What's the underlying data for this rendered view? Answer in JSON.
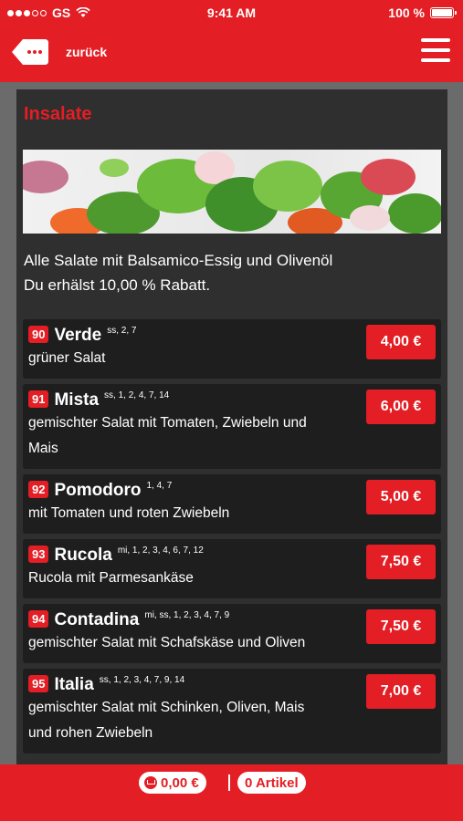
{
  "status_bar": {
    "carrier": "GS",
    "time": "9:41 AM",
    "battery": "100 %",
    "signal_icon": "signal-icon",
    "wifi_icon": "wifi-icon",
    "battery_icon": "battery-icon"
  },
  "nav": {
    "back_label": "zurück",
    "back_icon": "back-tag-icon",
    "menu_icon": "hamburger-menu-icon"
  },
  "section": {
    "title": "Insalate",
    "hero_image": "salad-photo",
    "intro_line1": "Alle Salate mit Balsamico-Essig und Olivenöl",
    "intro_line2": "Du erhälst 10,00 % Rabatt."
  },
  "items": [
    {
      "number": "90",
      "name": "Verde",
      "allergens": "ss, 2, 7",
      "description": "grüner Salat",
      "price": "4,00 €"
    },
    {
      "number": "91",
      "name": "Mista",
      "allergens": "ss, 1, 2, 4, 7, 14",
      "description": "gemischter Salat mit Tomaten, Zwiebeln und Mais",
      "price": "6,00 €"
    },
    {
      "number": "92",
      "name": "Pomodoro",
      "allergens": "1, 4, 7",
      "description": "mit Tomaten und roten Zwiebeln",
      "price": "5,00 €"
    },
    {
      "number": "93",
      "name": "Rucola",
      "allergens": "mi, 1, 2, 3, 4, 6, 7, 12",
      "description": "Rucola mit Parmesankäse",
      "price": "7,50 €"
    },
    {
      "number": "94",
      "name": "Contadina",
      "allergens": "mi, ss, 1, 2, 3, 4, 7, 9",
      "description": "gemischter Salat mit Schafskäse und Oliven",
      "price": "7,50 €"
    },
    {
      "number": "95",
      "name": "Italia",
      "allergens": "ss, 1, 2, 3, 4, 7, 9, 14",
      "description": "gemischter Salat mit Schinken, Oliven, Mais und rohen Zwiebeln",
      "price": "7,00 €"
    }
  ],
  "cart": {
    "total": "0,00 €",
    "count": "0 Artikel",
    "cart_icon": "cart-icon"
  },
  "colors": {
    "accent": "#e31e24",
    "panel": "#2f2f2f",
    "card": "#1e1e1e"
  }
}
